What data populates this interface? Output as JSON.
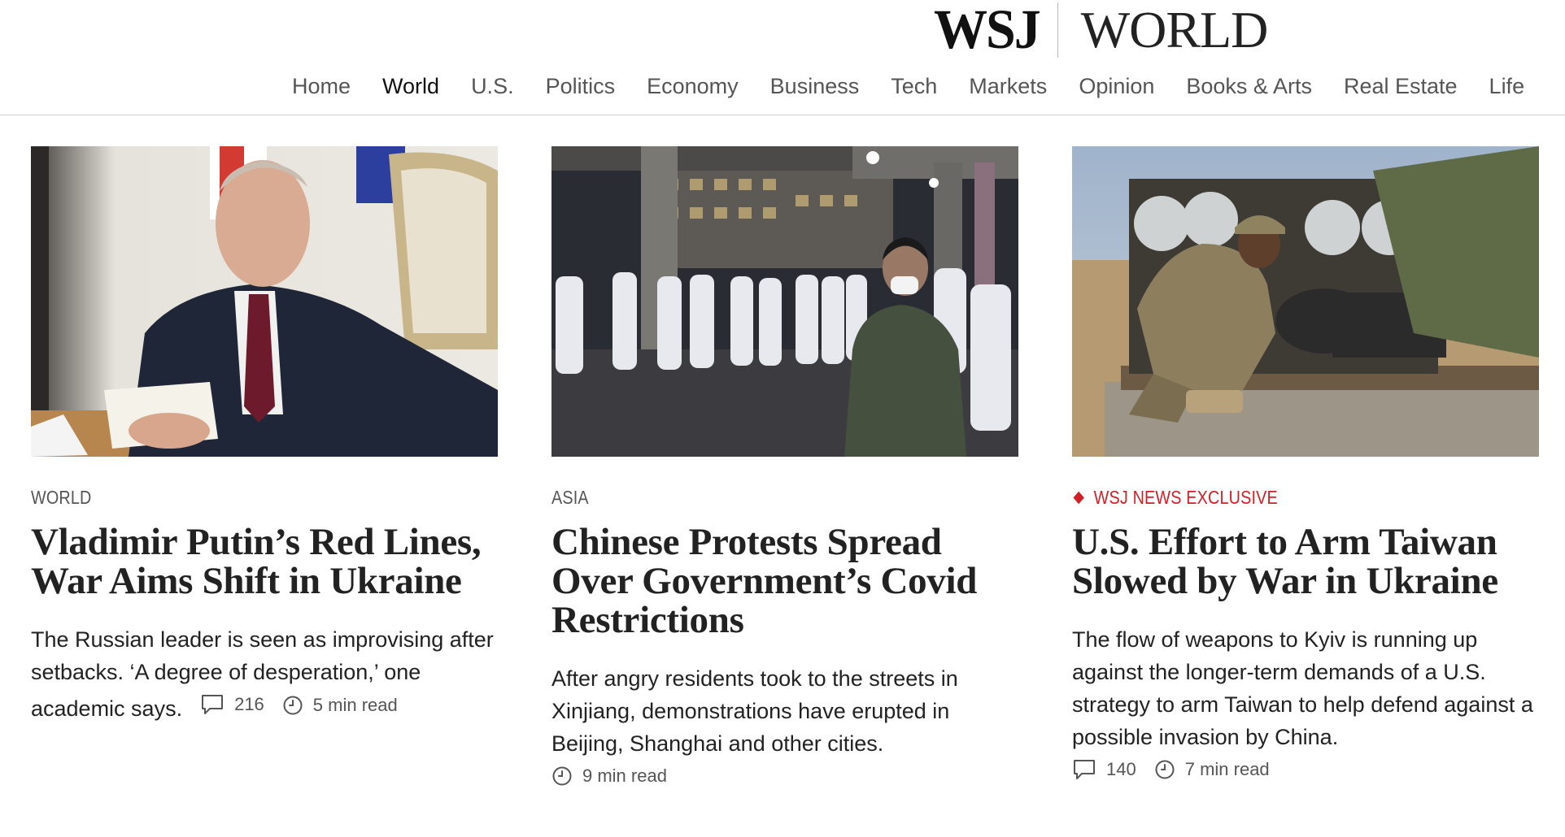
{
  "masthead": {
    "brand": "WSJ",
    "section": "WORLD"
  },
  "nav": {
    "items": [
      {
        "label": "Home"
      },
      {
        "label": "World"
      },
      {
        "label": "U.S."
      },
      {
        "label": "Politics"
      },
      {
        "label": "Economy"
      },
      {
        "label": "Business"
      },
      {
        "label": "Tech"
      },
      {
        "label": "Markets"
      },
      {
        "label": "Opinion"
      },
      {
        "label": "Books & Arts"
      },
      {
        "label": "Real Estate"
      },
      {
        "label": "Life"
      }
    ],
    "active": "World"
  },
  "cards": [
    {
      "kicker": "WORLD",
      "headline": "Vladimir Putin’s Red Lines, War Aims Shift in Ukraine",
      "summary": "The Russian leader is seen as improvising after setbacks. ‘A degree of desperation,’ one academic says.",
      "comments": "216",
      "read_time": "5 min read"
    },
    {
      "kicker": "ASIA",
      "headline": "Chinese Protests Spread Over Government’s Covid Restrictions",
      "summary": "After angry residents took to the streets in Xinjiang, demonstrations have erupted in Beijing, Shanghai and other cities.",
      "read_time": "9 min read"
    },
    {
      "kicker": "WSJ NEWS EXCLUSIVE",
      "kicker_color": "#d21f26",
      "headline": "U.S. Effort to Arm Taiwan Slowed by War in Ukraine",
      "summary": "The flow of weapons to Kyiv is running up against the longer-term demands of a U.S. strategy to arm Taiwan to help defend against a possible invasion by China.",
      "comments": "140",
      "read_time": "7 min read"
    }
  ],
  "icons": {
    "comment": "comment-icon",
    "clock": "clock-icon",
    "exclusive": "diamond-icon"
  },
  "colors": {
    "accent_red": "#d21f26",
    "text": "#222222",
    "muted": "#555555",
    "rule": "#cfcfcf"
  }
}
